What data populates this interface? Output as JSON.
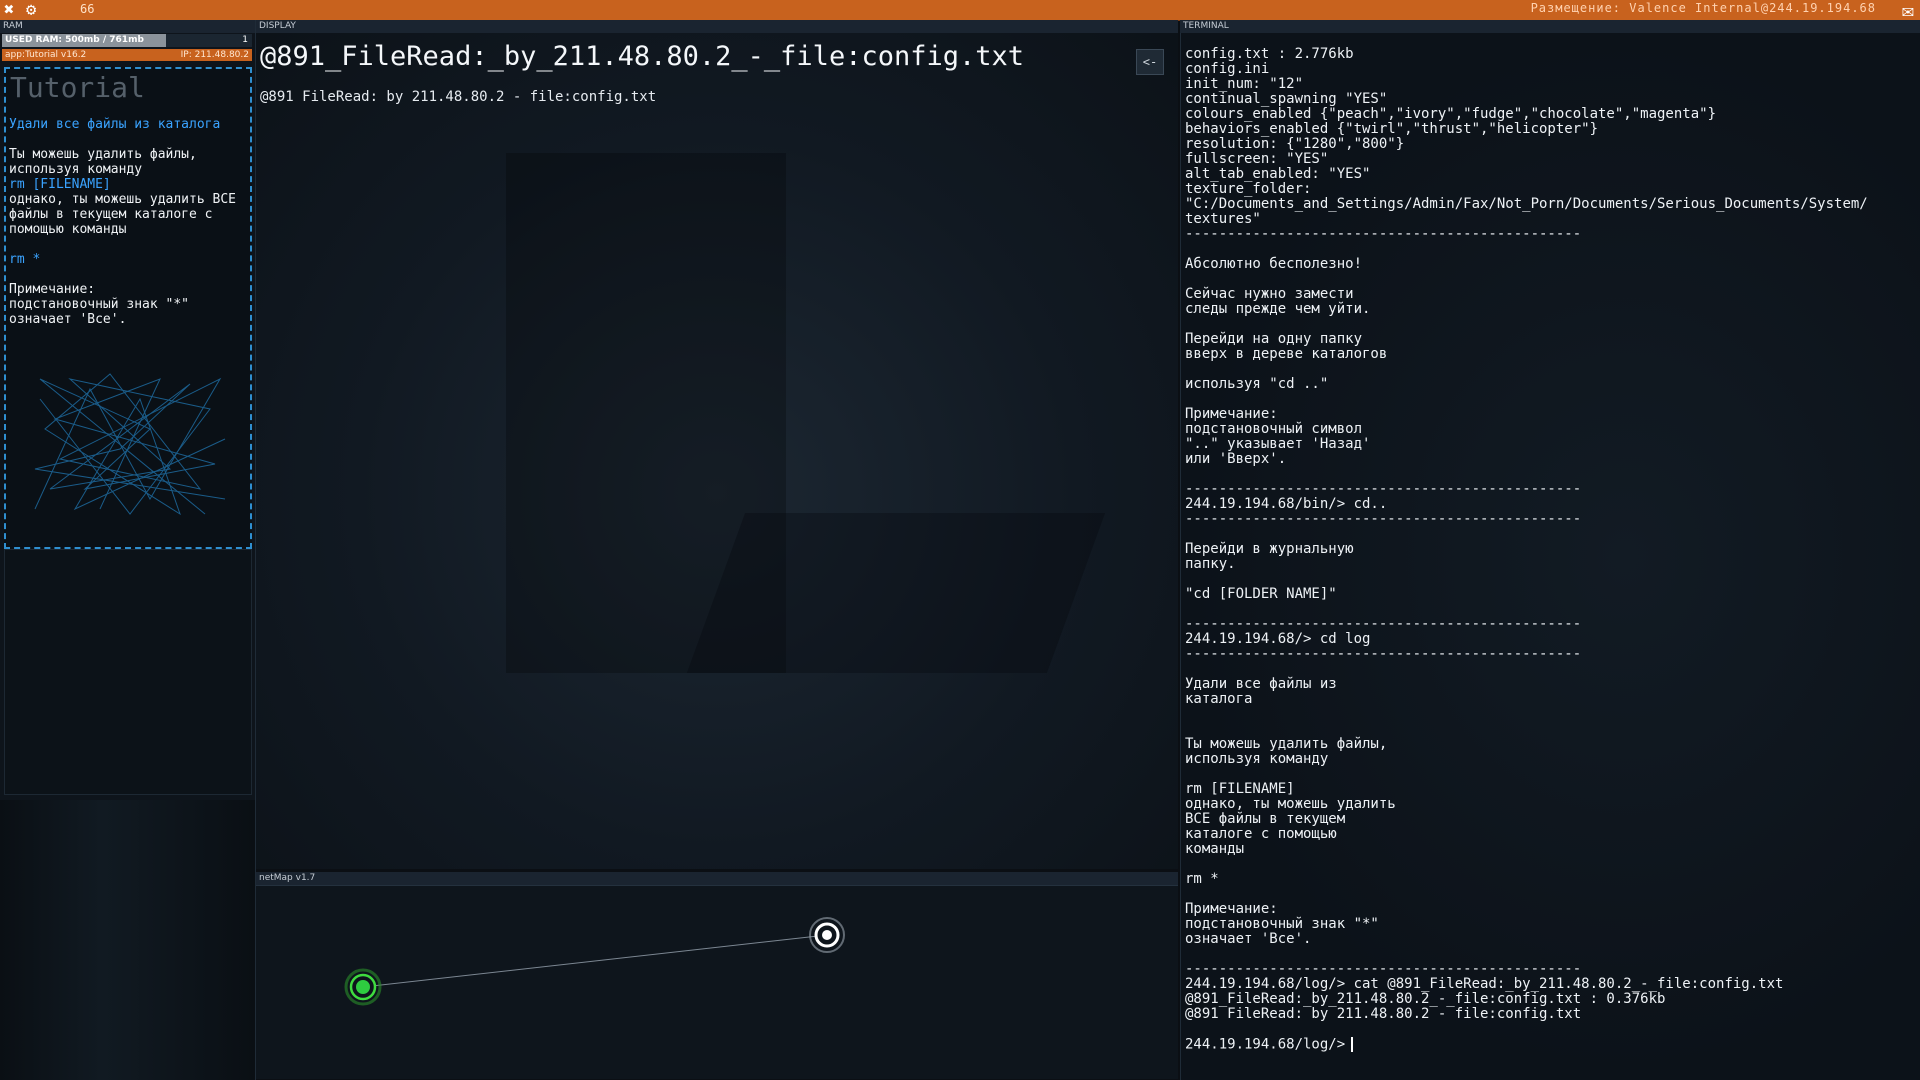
{
  "topbar": {
    "icons": [
      "close-icon",
      "gear-icon"
    ],
    "counter": "66",
    "location": "Размещение: Valence Internal@244.19.194.68",
    "mail_icon": "mail-icon"
  },
  "ram": {
    "label": "RAM",
    "used_text": "USED RAM: 500mb / 761mb",
    "used_fraction": 0.657,
    "count": "1",
    "app_label": "app:Tutorial v16.2",
    "ip_label": "IP: 211.48.80.2"
  },
  "tutorial": {
    "title": "Tutorial",
    "heading": "Удали все файлы из каталога",
    "body1": "Ты можешь удалить файлы, используя команду",
    "cmd1": "rm [FILENAME]",
    "body2": "однако, ты можешь удалить ВСЕ файлы в текущем каталоге с помощью команды",
    "cmd2": "rm *",
    "note": "Примечание:\nподстановочный знак \"*\"\nозначает 'Все'."
  },
  "display": {
    "label": "DISPLAY",
    "title": "@891_FileRead:_by_211.48.80.2_-_file:config.txt",
    "subtitle": "@891 FileRead: by 211.48.80.2 - file:config.txt",
    "back_label": "<-"
  },
  "netmap": {
    "label": "netMap v1.7"
  },
  "terminal": {
    "label": "TERMINAL",
    "lines": [
      "config.txt : 2.776kb",
      "config.ini",
      "init_num: \"12\"",
      "continual_spawning \"YES\"",
      "colours_enabled {\"peach\",\"ivory\",\"fudge\",\"chocolate\",\"magenta\"}",
      "behaviors_enabled {\"twirl\",\"thrust\",\"helicopter\"}",
      "resolution: {\"1280\",\"800\"}",
      "fullscreen: \"YES\"",
      "alt_tab_enabled: \"YES\"",
      "texture_folder:",
      "\"C:/Documents_and_Settings/Admin/Fax/Not_Porn/Documents/Serious_Documents/System/",
      "textures\"",
      "-----------------------------------------------",
      "",
      "Абсолютно бесполезно!",
      "",
      "Сейчас нужно замести",
      "следы прежде чем уйти.",
      "",
      "Перейди на одну папку",
      "вверх в дереве каталогов",
      "",
      "используя \"cd ..\"",
      "",
      "Примечание:",
      "подстановочный символ",
      "\"..\" указывает 'Назад'",
      "или 'Вверх'.",
      "",
      "-----------------------------------------------",
      "244.19.194.68/bin/> cd..",
      "-----------------------------------------------",
      "",
      "Перейди в журнальную",
      "папку.",
      "",
      "\"cd [FOLDER NAME]\"",
      "",
      "-----------------------------------------------",
      "244.19.194.68/> cd log",
      "-----------------------------------------------",
      "",
      "Удали все файлы из",
      "каталога",
      "",
      "",
      "Ты можешь удалить файлы,",
      "используя команду",
      "",
      "rm [FILENAME]",
      "однако, ты можешь удалить",
      "ВСЕ файлы в текущем",
      "каталоге с помощью",
      "команды",
      "",
      "rm *",
      "",
      "Примечание:",
      "подстановочный знак \"*\"",
      "означает 'Все'.",
      "",
      "-----------------------------------------------",
      "244.19.194.68/log/> cat @891_FileRead:_by_211.48.80.2_-_file:config.txt",
      "@891_FileRead:_by_211.48.80.2_-_file:config.txt : 0.376kb",
      "@891 FileRead: by 211.48.80.2 - file:config.txt",
      ""
    ],
    "prompt": "244.19.194.68/log/>"
  },
  "colors": {
    "accent": "#c8621e",
    "tutorial_blue": "#3aa3ff",
    "node_green": "#3fdc3f",
    "node_white": "#ffffff"
  }
}
